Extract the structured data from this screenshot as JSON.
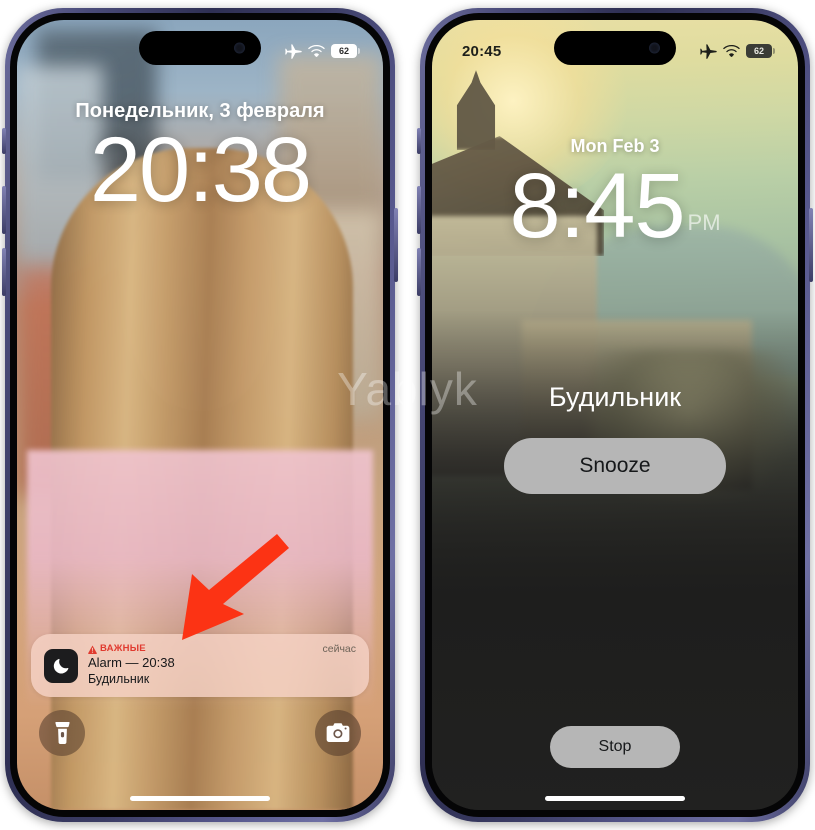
{
  "phones": {
    "left": {
      "name": "iphone-lockscreen-with-alarm-notification",
      "status_bar": {
        "time": "",
        "airplane_icon": "airplane-mode-icon",
        "wifi_icon": "wifi-icon",
        "battery_level": "62"
      },
      "lock_screen": {
        "date": "Понедельник, 3 февраля",
        "time": "20:38"
      },
      "notification": {
        "category_icon": "alert-triangle-icon",
        "category": "ВАЖНЫЕ",
        "app_icon": "crescent-moon-icon",
        "title": "Alarm — 20:38",
        "subtitle": "Будильник",
        "timestamp": "сейчас"
      },
      "quick_actions": {
        "flashlight": "flashlight-icon",
        "camera": "camera-icon"
      }
    },
    "right": {
      "name": "iphone-alarm-ringing-screen",
      "status_bar": {
        "time": "20:45",
        "airplane_icon": "airplane-mode-icon",
        "wifi_icon": "wifi-icon",
        "battery_level": "62"
      },
      "lock_screen": {
        "date": "Mon Feb 3",
        "time": "8:45",
        "meridiem": "PM"
      },
      "alarm": {
        "title": "Будильник",
        "snooze_label": "Snooze",
        "stop_label": "Stop"
      }
    }
  },
  "annotation": {
    "arrow_color": "#FC3314",
    "arrow_name": "red-arrow-pointing-to-notification"
  },
  "watermark": {
    "text": "Yablyk"
  },
  "colors": {
    "frame": "#4a4b79",
    "notification_bg": "#f6d3c7",
    "alert_red": "#e03a2f",
    "button_gray": "#b6b6b6"
  }
}
